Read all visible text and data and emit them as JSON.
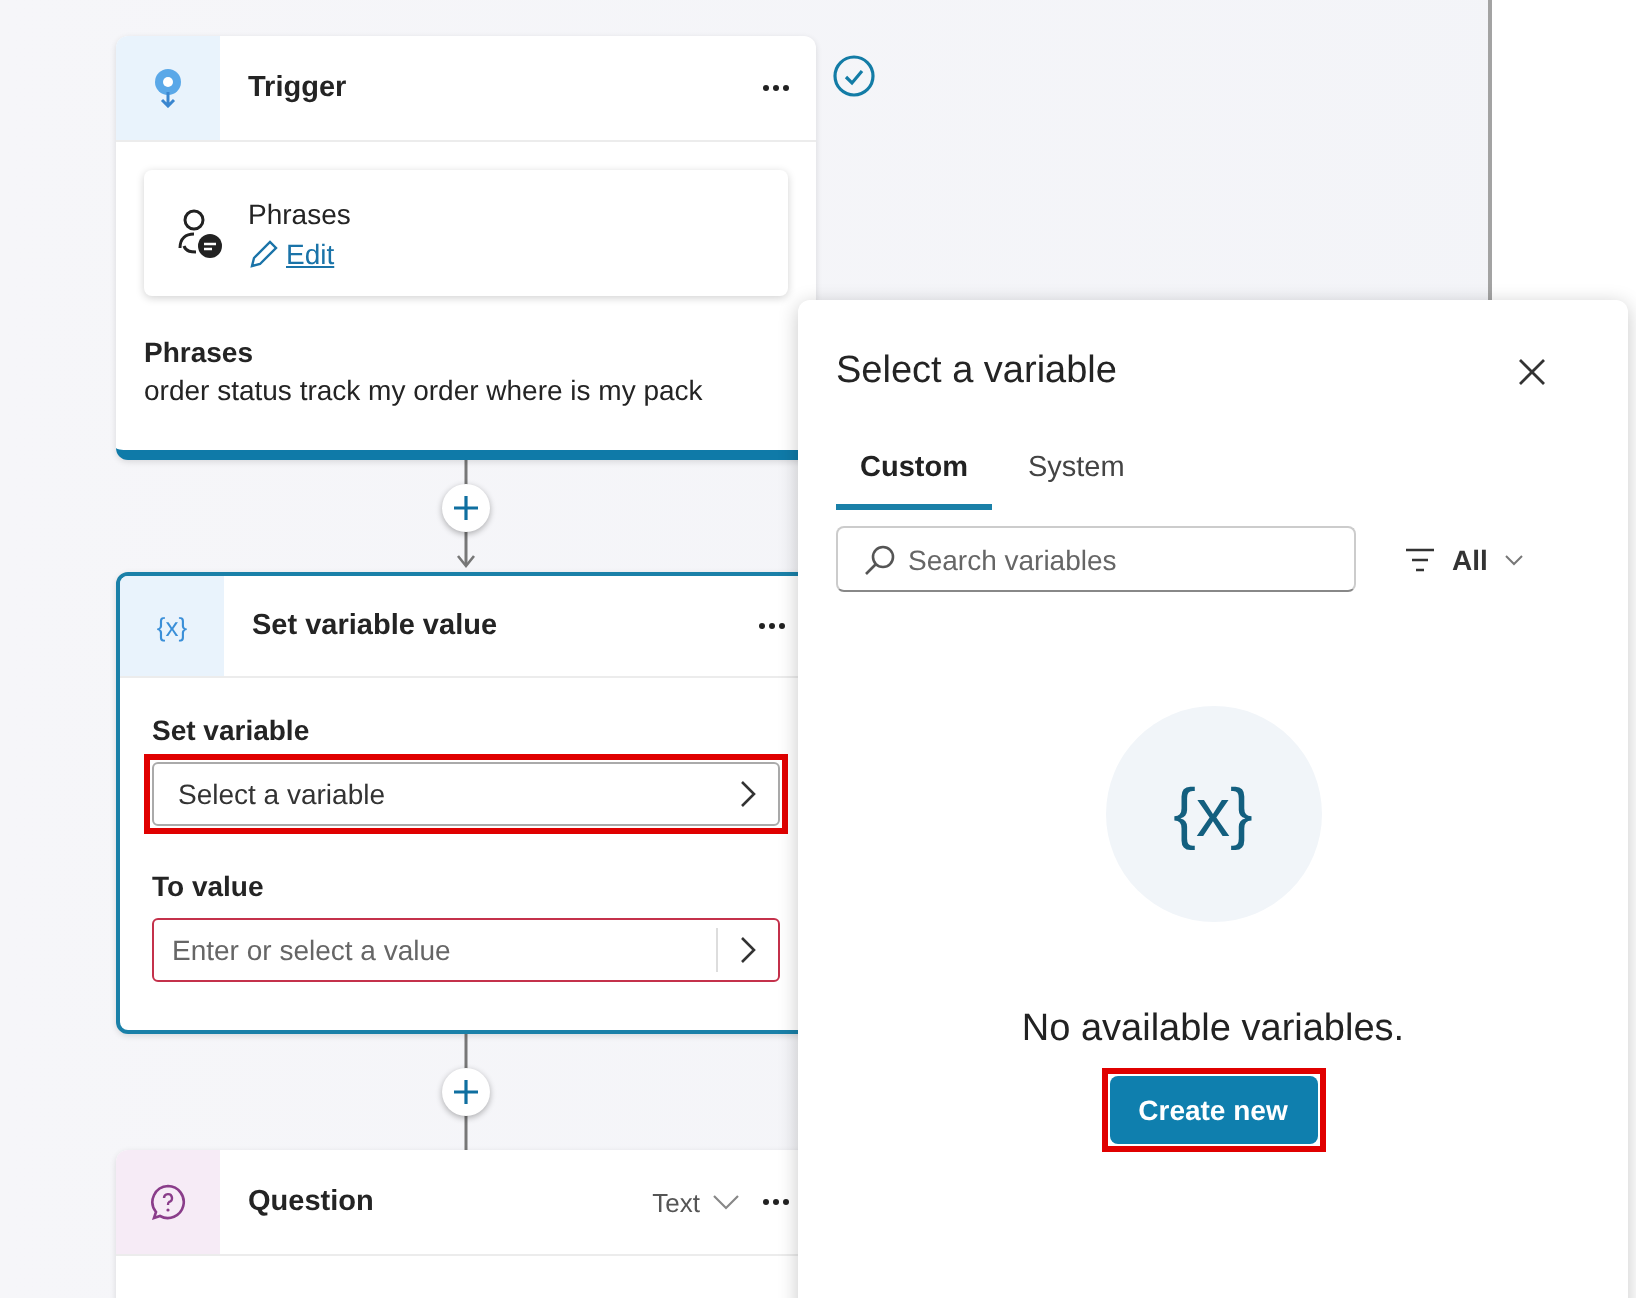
{
  "trigger": {
    "title": "Trigger",
    "card": {
      "title": "Phrases",
      "link": "Edit"
    },
    "section_label": "Phrases",
    "phrases": "order status track my order where is my pack"
  },
  "set_variable": {
    "title": "Set variable value",
    "icon_text": "{x}",
    "fields": [
      {
        "label": "Set variable",
        "placeholder": "Select a variable",
        "kind": "picker",
        "highlighted": true,
        "error": false
      },
      {
        "label": "To value",
        "placeholder": "Enter or select a value",
        "kind": "input",
        "highlighted": false,
        "error": true
      }
    ]
  },
  "question": {
    "title": "Question",
    "type": "Text"
  },
  "popover": {
    "title": "Select a variable",
    "tabs": [
      {
        "label": "Custom",
        "selected": true
      },
      {
        "label": "System",
        "selected": false
      }
    ],
    "search": {
      "placeholder": "Search variables"
    },
    "filter": "All",
    "empty_icon_text": "{x}",
    "empty_message": "No available variables.",
    "button": {
      "label": "Create new",
      "highlighted": true
    }
  }
}
